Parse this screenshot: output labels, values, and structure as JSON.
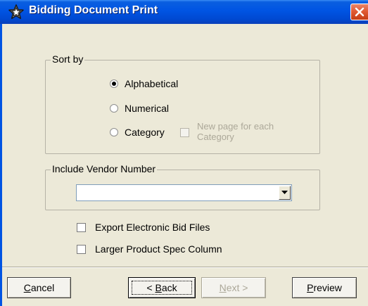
{
  "window": {
    "title": "Bidding Document Print"
  },
  "sort_by": {
    "label": "Sort by",
    "options": [
      {
        "label": "Alphabetical",
        "checked": true
      },
      {
        "label": "Numerical",
        "checked": false
      },
      {
        "label": "Category",
        "checked": false
      }
    ],
    "new_page_line1": "New page for each",
    "new_page_line2": "Category",
    "new_page_checked": false
  },
  "vendor": {
    "label": "Include Vendor Number",
    "value": ""
  },
  "options": {
    "export_label": "Export Electronic Bid Files",
    "export_checked": false,
    "larger_label": "Larger Product Spec Column",
    "larger_checked": false
  },
  "buttons": {
    "cancel_first": "C",
    "cancel_rest": "ancel",
    "back_prefix": "< ",
    "back_first": "B",
    "back_rest": "ack",
    "next_first": "N",
    "next_rest": "ext >",
    "preview_first": "P",
    "preview_rest": "review"
  },
  "colors": {
    "titlebar": "#0054e3",
    "dialog_bg": "#ece9d8",
    "close_button": "#e25b35"
  },
  "icons": {
    "title": "star-outline-icon",
    "close": "close-icon",
    "dropdown": "chevron-down-icon"
  }
}
